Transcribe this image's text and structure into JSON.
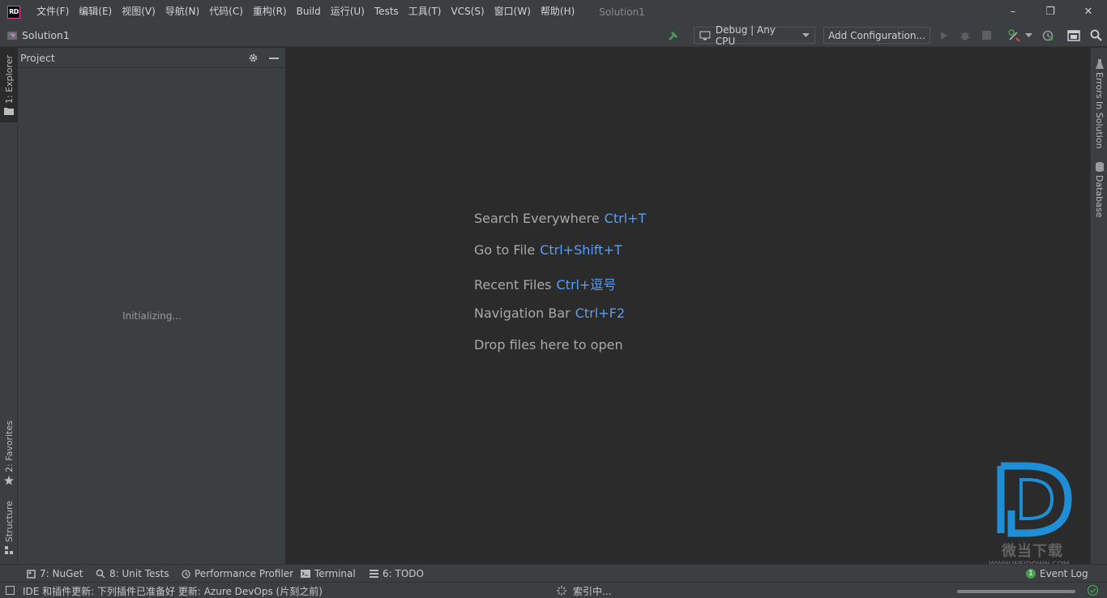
{
  "app": {
    "logo_text": "RD",
    "window_title": "Solution1",
    "menu": [
      "文件(F)",
      "编辑(E)",
      "视图(V)",
      "导航(N)",
      "代码(C)",
      "重构(R)",
      "Build",
      "运行(U)",
      "Tests",
      "工具(T)",
      "VCS(S)",
      "窗口(W)",
      "帮助(H)"
    ],
    "window_controls": {
      "minimize": "–",
      "restore": "❐",
      "close": "✕"
    }
  },
  "toolbar": {
    "breadcrumb": "Solution1",
    "configuration": "Debug | Any CPU",
    "add_configuration": "Add Configuration..."
  },
  "left_tabs": {
    "explorer": "1: Explorer",
    "favorites": "2: Favorites",
    "structure": "Structure"
  },
  "right_tabs": {
    "errors": "Errors In Solution",
    "database": "Database"
  },
  "project_panel": {
    "title": "Project",
    "status": "Initializing..."
  },
  "editor": {
    "hints": [
      {
        "label": "Search Everywhere",
        "key": "Ctrl+T"
      },
      {
        "label": "Go to File",
        "key": "Ctrl+Shift+T"
      },
      {
        "label": "Recent Files",
        "key": "Ctrl+逗号"
      },
      {
        "label": "Navigation Bar",
        "key": "Ctrl+F2"
      },
      {
        "label": "Drop files here to open",
        "key": ""
      }
    ]
  },
  "bottom_tabs": {
    "nuget": "7: NuGet",
    "unit_tests": "8: Unit Tests",
    "profiler": "Performance Profiler",
    "terminal": "Terminal",
    "todo": "6: TODO",
    "event_log": "Event Log",
    "event_log_count": "1"
  },
  "status_bar": {
    "message": "IDE 和插件更新: 下列插件已准备好 更新: Azure DevOps (片刻之前)",
    "indexing": "索引中..."
  },
  "watermark": {
    "text": "微当下载",
    "url": "WWW.WEIDOWN.COM"
  },
  "colors": {
    "background": "#2b2b2b",
    "panel": "#3c3f41",
    "shortcut_blue": "#589df6",
    "build_green": "#499c54",
    "watermark_blue": "#1e8fd6"
  }
}
